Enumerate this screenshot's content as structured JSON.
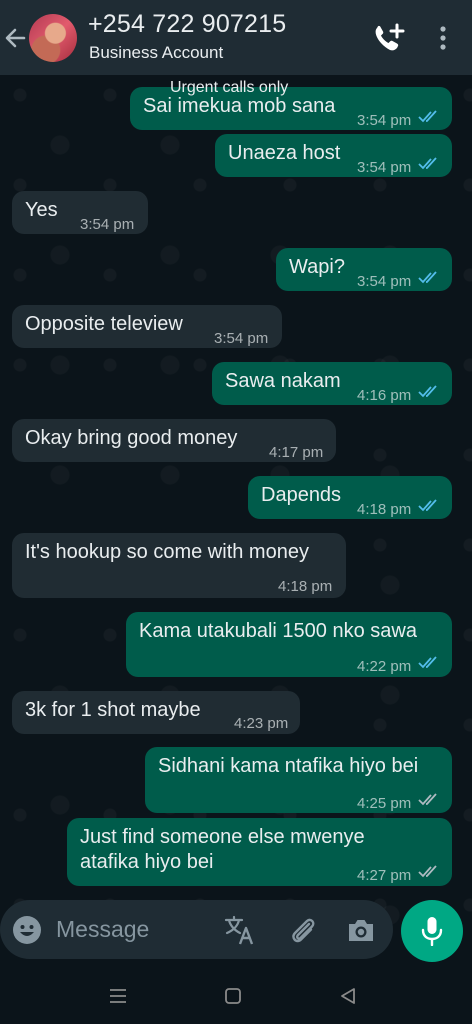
{
  "header": {
    "contact_name": "+254 722 907215",
    "contact_subtitle": "Business Account",
    "icons": [
      "back-arrow",
      "add-call",
      "more-vertical"
    ]
  },
  "status_note": "Urgent calls only",
  "messages": [
    {
      "dir": "out",
      "text": "Sai imekua mob sana",
      "time": "3:54 pm",
      "ticks": "read"
    },
    {
      "dir": "out",
      "text": "Unaeza host",
      "time": "3:54 pm",
      "ticks": "read"
    },
    {
      "dir": "in",
      "text": "Yes",
      "time": "3:54 pm"
    },
    {
      "dir": "out",
      "text": "Wapi?",
      "time": "3:54 pm",
      "ticks": "read"
    },
    {
      "dir": "in",
      "text": "Opposite teleview",
      "time": "3:54 pm"
    },
    {
      "dir": "out",
      "text": "Sawa nakam",
      "time": "4:16 pm",
      "ticks": "read"
    },
    {
      "dir": "in",
      "text": "Okay bring good money",
      "time": "4:17 pm"
    },
    {
      "dir": "out",
      "text": "Dapends",
      "time": "4:18 pm",
      "ticks": "read"
    },
    {
      "dir": "in",
      "text": "It's hookup so come with money",
      "time": "4:18 pm"
    },
    {
      "dir": "out",
      "text": "Kama utakubali 1500 nko sawa",
      "time": "4:22 pm",
      "ticks": "read"
    },
    {
      "dir": "in",
      "text": "3k for 1 shot maybe",
      "time": "4:23 pm"
    },
    {
      "dir": "out",
      "text": "Sidhani kama ntafika hiyo bei",
      "time": "4:25 pm",
      "ticks": "delivered"
    },
    {
      "dir": "out",
      "text": "Just find someone else mwenye",
      "text2": "atafika hiyo bei",
      "time": "4:27 pm",
      "ticks": "delivered"
    }
  ],
  "input": {
    "placeholder": "Message",
    "icons": [
      "emoji",
      "translate",
      "attach",
      "camera",
      "mic"
    ]
  },
  "colors": {
    "header_bg": "#1f2c34",
    "chat_bg": "#0b141a",
    "outgoing_bubble": "#005c4b",
    "incoming_bubble": "#202c33",
    "accent": "#00a884",
    "read_ticks": "#53bdeb"
  }
}
